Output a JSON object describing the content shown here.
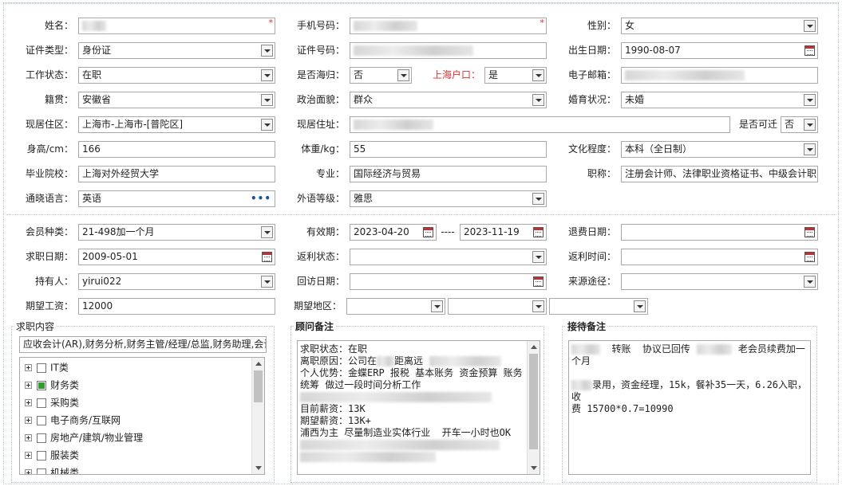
{
  "basic": {
    "name_label": "姓名：",
    "phone_label": "手机号码：",
    "gender_label": "性别：",
    "gender_value": "女",
    "id_type_label": "证件类型：",
    "id_type_value": "身份证",
    "id_no_label": "证件号码：",
    "birth_label": "出生日期：",
    "birth_value": "1990-08-07",
    "work_status_label": "工作状态：",
    "work_status_value": "在职",
    "overseas_label": "是否海归：",
    "overseas_value": "否",
    "shanghai_hukou_label": "上海户口：",
    "shanghai_hukou_value": "是",
    "email_label": "电子邮箱：",
    "native_label": "籍贯：",
    "native_value": "安徽省",
    "political_label": "政治面貌：",
    "political_value": "群众",
    "marital_label": "婚育状况：",
    "marital_value": "未婚",
    "residence_area_label": "现居住区：",
    "residence_area_value": "上海市-上海市-[普陀区]",
    "residence_addr_label": "现居住址：",
    "migratable_label": "是否可迁",
    "migratable_value": "否",
    "height_label": "身高/cm：",
    "height_value": "166",
    "weight_label": "体重/kg：",
    "weight_value": "55",
    "education_label": "文化程度：",
    "education_value": "本科（全日制）",
    "school_label": "毕业院校：",
    "school_value": "上海对外经贸大学",
    "major_label": "专业：",
    "major_value": "国际经济与贸易",
    "title_label": "职称：",
    "title_value": "注册会计师、法律职业资格证书、中级会计职",
    "language_label": "通晓语言：",
    "language_value": "英语",
    "foreign_level_label": "外语等级：",
    "foreign_level_value": "雅思"
  },
  "member": {
    "type_label": "会员种类：",
    "type_value": "21-498加一个月",
    "valid_label": "有效期：",
    "valid_from": "2023-04-20",
    "valid_sep": "----",
    "valid_to": "2023-11-19",
    "refund_date_label": "退费日期：",
    "job_date_label": "求职日期：",
    "job_date_value": "2009-05-01",
    "rebate_status_label": "返利状态：",
    "rebate_time_label": "返利时间：",
    "holder_label": "持有人：",
    "holder_value": "yirui022",
    "visit_date_label": "回访日期：",
    "source_label": "来源途径：",
    "salary_label": "期望工资：",
    "salary_value": "12000",
    "area_label": "期望地区："
  },
  "job_content": {
    "title": "求职内容",
    "summary": "应收会计(AR),财务分析,财务主管/经理/总监,财务助理,会计",
    "items": [
      {
        "label": "IT类",
        "checked": false
      },
      {
        "label": "财务类",
        "checked": true
      },
      {
        "label": "采购类",
        "checked": false
      },
      {
        "label": "电子商务/互联网",
        "checked": false
      },
      {
        "label": "房地产/建筑/物业管理",
        "checked": false
      },
      {
        "label": "服装类",
        "checked": false
      },
      {
        "label": "机械类",
        "checked": false
      }
    ]
  },
  "advisor_notes": {
    "title": "顾问备注",
    "lines": [
      "求职状态：在职",
      "离职原因：公司在",
      "个人优势：金蝶ERP 报税 基本账务 资金预算 账务",
      "统筹 做过一段时间分析工作",
      "",
      "目前薪资：13K",
      "期望薪资：13K+",
      "浦西为主 尽量制造业实体行业  开车一小时也OK"
    ],
    "distance_text": "距离远"
  },
  "reception_notes": {
    "title": "接待备注",
    "line1_a": "转账  协议已回传",
    "line1_b": "老会员续费加一",
    "line2": "个月",
    "line3": "录用，资金经理，15k，餐补35一天，6.26入职，收",
    "line4": "费 15700*0.7=10990"
  },
  "colors": {
    "required": "#e03030",
    "checked": "#2e9b2e",
    "border": "#a9a9a9"
  }
}
